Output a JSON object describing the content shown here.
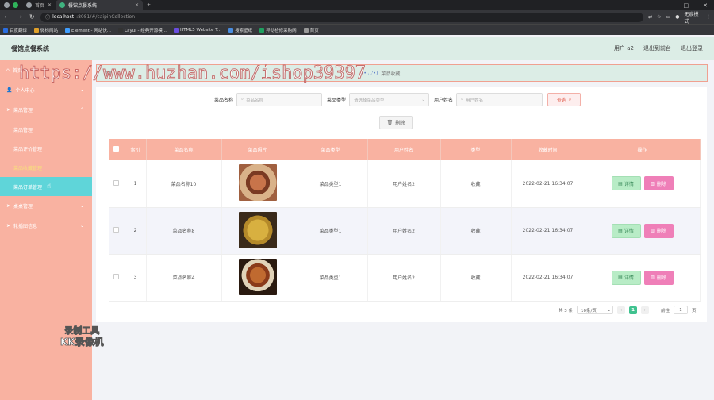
{
  "browser": {
    "tabs": [
      {
        "label": "首页"
      },
      {
        "label": "餐馆点餐系统"
      }
    ],
    "new_tab": "+",
    "window_controls": [
      "–",
      "□",
      "✕"
    ],
    "url_host": "localhost",
    "url_path": ":8081/#/caipinCollection",
    "profile": "无痕模式",
    "bookmarks": [
      {
        "label": "百度翻译",
        "color": "#2a6de0"
      },
      {
        "label": "微标网站",
        "color": "#e0a02a"
      },
      {
        "label": "Element - 网站快...",
        "color": "#409eff"
      },
      {
        "label": "Layui - 经典开源模...",
        "color": "#333333"
      },
      {
        "label": "HTML5 Website T...",
        "color": "#6a4de0"
      },
      {
        "label": "搜索壁纸",
        "color": "#4a8de0"
      },
      {
        "label": "异动检修采购网",
        "color": "#20a060"
      },
      {
        "label": "首页",
        "color": "#999999"
      }
    ]
  },
  "header": {
    "title": "餐馆点餐系统",
    "user": "用户 a2",
    "backend": "退出到前台",
    "logout": "退出登录"
  },
  "sidebar": {
    "items": [
      {
        "label": "首页",
        "icon": "home-icon",
        "expandable": false
      },
      {
        "label": "个人中心",
        "icon": "user-icon",
        "expandable": true
      },
      {
        "label": "菜品管理",
        "icon": "send-icon",
        "expandable": true
      }
    ],
    "sub_items": [
      {
        "label": "菜品管理"
      },
      {
        "label": "菜品评价管理"
      },
      {
        "label": "菜品收藏管理"
      },
      {
        "label": "菜品订单管理"
      }
    ],
    "bottom_items": [
      {
        "label": "桌桌管理",
        "icon": "send-icon"
      },
      {
        "label": "轮播图信息",
        "icon": "send-icon"
      }
    ]
  },
  "breadcrumb": {
    "first": "首页",
    "emoji": "(•'◡'•)",
    "current": "菜品收藏"
  },
  "filters": {
    "name_label": "菜品名称",
    "name_placeholder": "菜品名称",
    "type_label": "菜品类型",
    "type_placeholder": "请选择菜品类型",
    "user_label": "用户姓名",
    "user_placeholder": "用户姓名",
    "query_button": "查询"
  },
  "delete_button": "删除",
  "table": {
    "headers": [
      "索引",
      "菜品名称",
      "菜品照片",
      "菜品类型",
      "用户姓名",
      "类型",
      "收藏时间",
      "操作"
    ],
    "rows": [
      {
        "index": "1",
        "name": "菜品名称10",
        "type": "菜品类型1",
        "user": "用户姓名2",
        "kind": "收藏",
        "time": "2022-02-21 16:34:07"
      },
      {
        "index": "2",
        "name": "菜品名称8",
        "type": "菜品类型1",
        "user": "用户姓名2",
        "kind": "收藏",
        "time": "2022-02-21 16:34:07"
      },
      {
        "index": "3",
        "name": "菜品名称4",
        "type": "菜品类型1",
        "user": "用户姓名2",
        "kind": "收藏",
        "time": "2022-02-21 16:34:07"
      }
    ],
    "detail_label": "详情",
    "remove_label": "删除"
  },
  "pagination": {
    "total": "共 3 条",
    "page_size": "10条/页",
    "current": "1",
    "goto": "前往",
    "goto_value": "1",
    "page_unit": "页"
  },
  "watermark": "https://www.huzhan.com/ishop39397",
  "recorder_watermark": {
    "line1": "录制工具",
    "line2": "KK录像机"
  }
}
